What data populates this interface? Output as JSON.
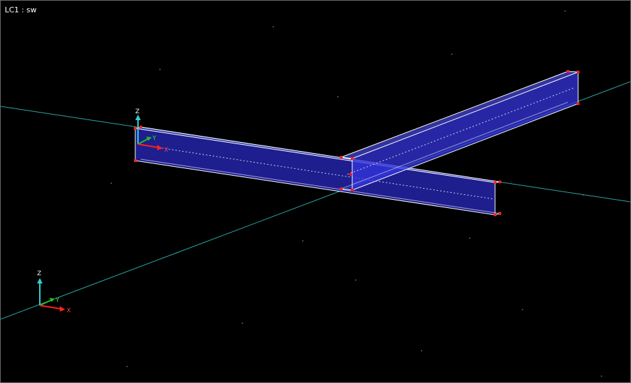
{
  "viewport": {
    "view_label": "LC1 : sw"
  },
  "global_axes": {
    "x_label": "X",
    "y_label": "Y",
    "z_label": "Z"
  },
  "local_axes": {
    "x_label": "X",
    "y_label": "Y",
    "z_label": "Z"
  },
  "colors": {
    "background": "#000000",
    "grid_line": "#2aa6a6",
    "member_fill": "#2b2bcc",
    "member_edge": "#ffffff",
    "node": "#ff2020",
    "axis_x": "#ff2020",
    "axis_y": "#20c020",
    "axis_z": "#30d0d0"
  },
  "icons": [
    "global-axis-triad-icon",
    "local-axis-triad-icon"
  ]
}
